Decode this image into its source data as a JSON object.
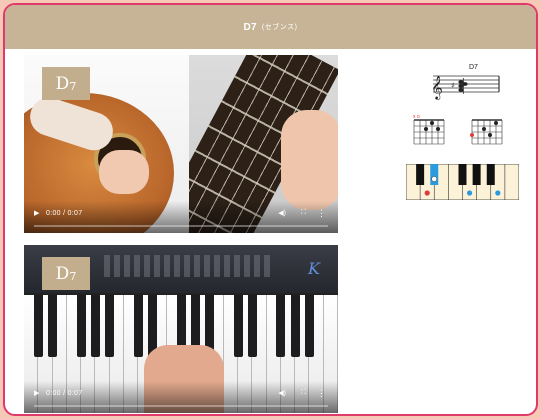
{
  "header": {
    "chord": "D7",
    "reading": "(セブンス)"
  },
  "videos": [
    {
      "label_root": "D",
      "label_ext": "7",
      "time": "0:00 / 0:07",
      "progress": 0
    },
    {
      "label_root": "D",
      "label_ext": "7",
      "time": "0:00 / 0:07",
      "progress": 0
    }
  ],
  "piano_brand": "K",
  "diagrams": {
    "staff_label": "D7",
    "fret_marks": "x o",
    "accent_red": "#e03a3a",
    "accent_blue": "#2b9be0"
  }
}
